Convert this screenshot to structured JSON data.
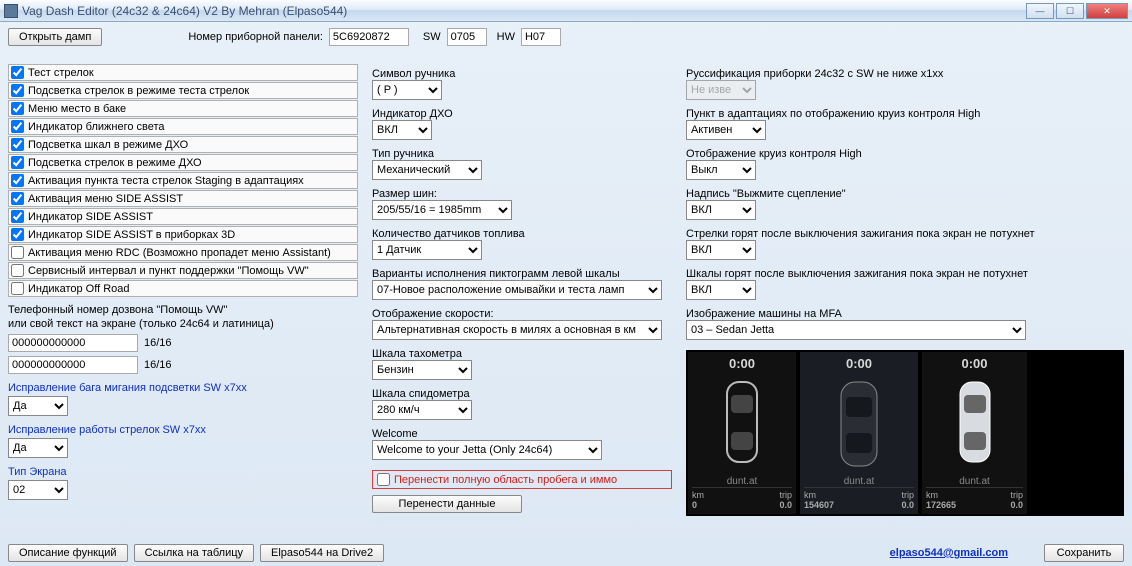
{
  "window": {
    "title": "Vag Dash Editor (24c32 & 24c64) V2  By Mehran (Elpaso544)"
  },
  "toprow": {
    "open_dump": "Открыть дамп",
    "panel_label": "Номер приборной панели:",
    "panel_value": "5C6920872",
    "sw_label": "SW",
    "sw_value": "0705",
    "hw_label": "HW",
    "hw_value": "H07"
  },
  "checkboxes": [
    "Тест стрелок",
    "Подсветка стрелок в режиме теста стрелок",
    "Меню место в баке",
    "Индикатор ближнего света",
    "Подсветка шкал в режиме ДХО",
    "Подсветка стрелок в режиме ДХО",
    "Активация пункта теста стрелок Staging в адаптациях",
    "Активация меню SIDE ASSIST",
    "Индикатор SIDE ASSIST",
    "Индикатор SIDE ASSIST в приборках 3D",
    "Активация меню RDC (Возможно пропадет меню Assistant)",
    "Сервисный интервал и пункт поддержки \"Помощь VW\"",
    "Индикатор Off Road"
  ],
  "checkbox_states": [
    true,
    true,
    true,
    true,
    true,
    true,
    true,
    true,
    true,
    true,
    false,
    false,
    false
  ],
  "phone": {
    "label1": "Телефонный номер дозвона \"Помощь VW\"",
    "label2": "или свой текст на экране (только 24c64 и латиница)",
    "val1": "000000000000",
    "count1": "16/16",
    "val2": "000000000000",
    "count2": "16/16"
  },
  "fixbug": {
    "label": "Исправление бага мигания подсветки SW x7xx",
    "value": "Да"
  },
  "fixarrow": {
    "label": "Исправление работы стрелок SW x7xx",
    "value": "Да"
  },
  "screentype": {
    "label": "Тип Экрана",
    "value": "02"
  },
  "col2": {
    "f1": {
      "label": "Символ ручника",
      "value": "( P )"
    },
    "f2": {
      "label": "Индикатор ДХО",
      "value": "ВКЛ"
    },
    "f3": {
      "label": "Тип ручника",
      "value": "Механический"
    },
    "f4": {
      "label": "Размер шин:",
      "value": "205/55/16 = 1985mm"
    },
    "f5": {
      "label": "Количество датчиков топлива",
      "value": "1 Датчик"
    },
    "f6": {
      "label": "Варианты исполнения пиктограмм левой шкалы",
      "value": "07-Новое расположение омывайки и теста ламп"
    },
    "f7": {
      "label": "Отображение скорости:",
      "value": "Альтернативная скорость в милях а основная в км"
    },
    "f8": {
      "label": "Шкала тахометра",
      "value": "Бензин"
    },
    "f9": {
      "label": "Шкала спидометра",
      "value": "280 км/ч"
    },
    "f10": {
      "label": "Welcome",
      "value": "Welcome to your Jetta (Only 24c64)"
    },
    "red": "Перенести полную область пробега и иммо",
    "btn": "Перенести данные"
  },
  "col3": {
    "f1": {
      "label": "Руссификация приборки 24c32 с SW не ниже x1xx",
      "value": "Не изве"
    },
    "f2": {
      "label": "Пункт в адаптациях по отображению круиз контроля High",
      "value": "Активен"
    },
    "f3": {
      "label": "Отображение круиз контроля High",
      "value": "Выкл"
    },
    "f4": {
      "label": "Надпись \"Выжмите сцепление\"",
      "value": "ВКЛ"
    },
    "f5": {
      "label": "Стрелки горят после выключения зажигания пока экран не потухнет",
      "value": "ВКЛ"
    },
    "f6": {
      "label": "Шкалы горят после выключения зажигания пока экран не потухнет",
      "value": "ВКЛ"
    },
    "f7": {
      "label": "Изображение машины на MFA",
      "value": "03 – Sedan Jetta"
    }
  },
  "previews": {
    "time": "0:00",
    "brand": "dunt.at",
    "p1": {
      "km": "0",
      "trip": "0.0"
    },
    "p2": {
      "km": "154607",
      "trip": "0.0"
    },
    "p3": {
      "km": "172665",
      "trip": "0.0"
    }
  },
  "footer": {
    "b1": "Описание функций",
    "b2": "Ссылка на таблицу",
    "b3": "Elpaso544 на Drive2",
    "email": "elpaso544@gmail.com",
    "save": "Сохранить"
  }
}
